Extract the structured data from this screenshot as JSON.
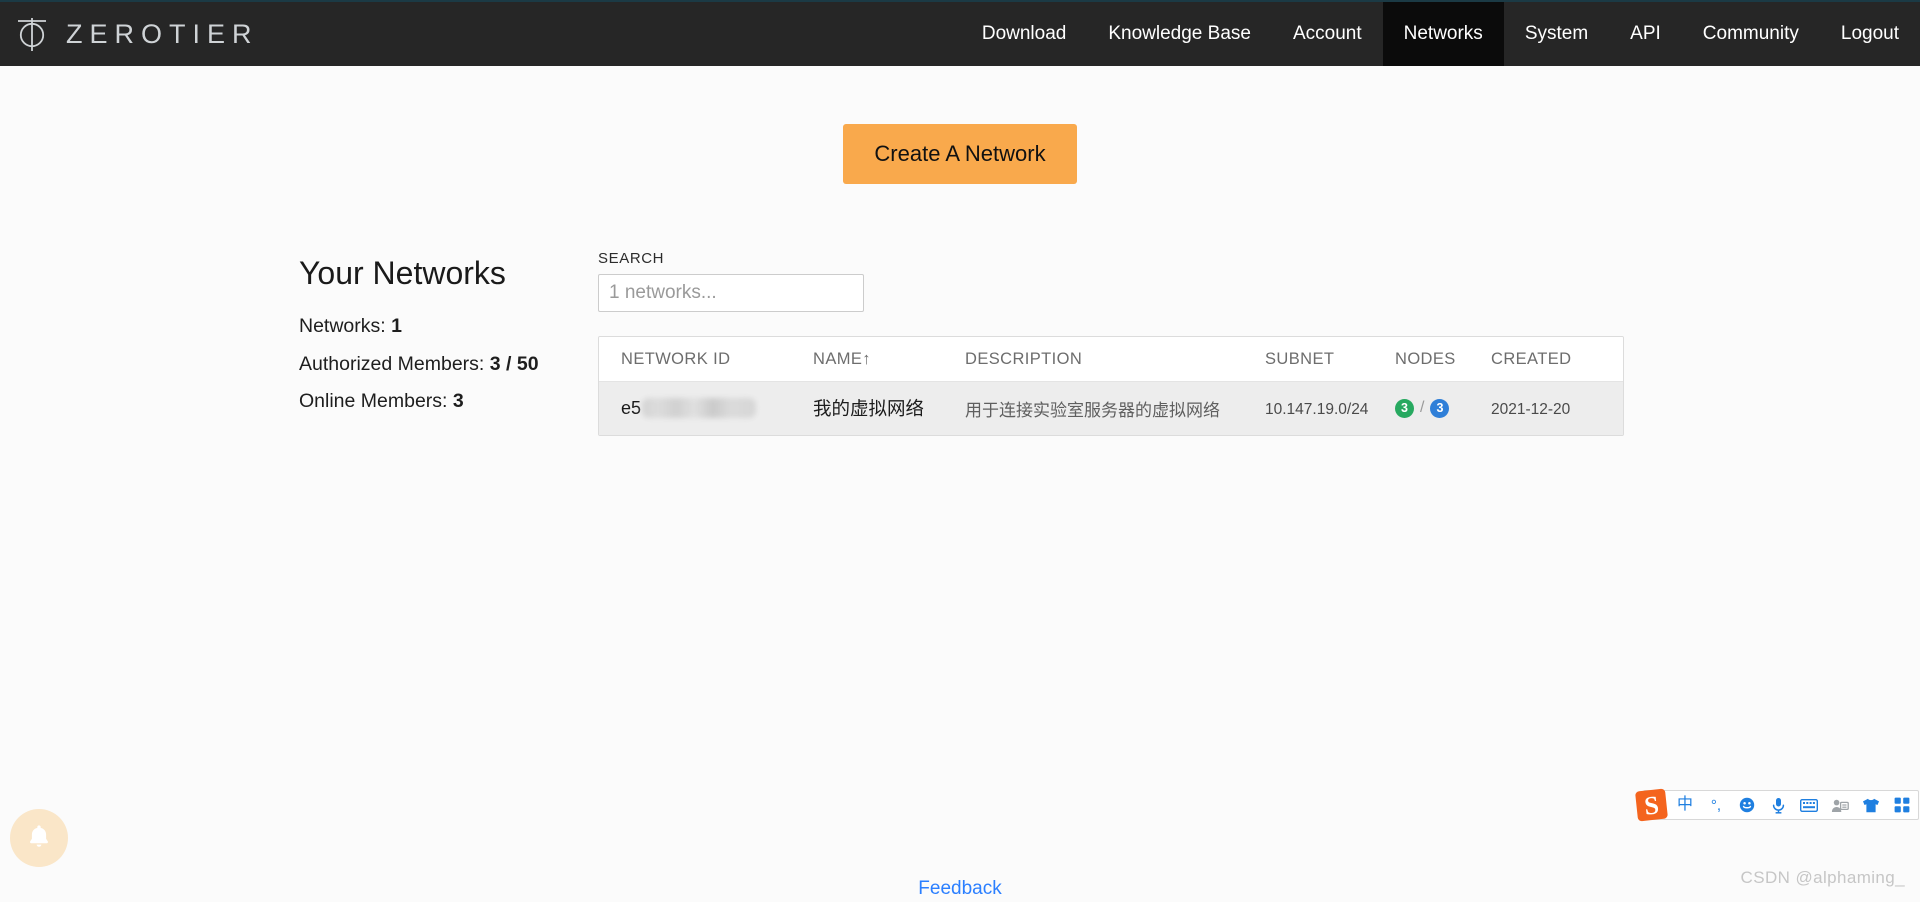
{
  "brand": {
    "name": "ZEROTIER",
    "logo_icon": "zerotier-logo-icon"
  },
  "nav": {
    "items": [
      {
        "label": "Download",
        "active": false
      },
      {
        "label": "Knowledge Base",
        "active": false
      },
      {
        "label": "Account",
        "active": false
      },
      {
        "label": "Networks",
        "active": true
      },
      {
        "label": "System",
        "active": false
      },
      {
        "label": "API",
        "active": false
      },
      {
        "label": "Community",
        "active": false
      },
      {
        "label": "Logout",
        "active": false
      }
    ]
  },
  "actions": {
    "create_network_label": "Create A Network"
  },
  "summary": {
    "title": "Your Networks",
    "networks_label": "Networks:",
    "networks_value": "1",
    "authorized_label": "Authorized Members:",
    "authorized_value": "3 / 50",
    "online_label": "Online Members:",
    "online_value": "3"
  },
  "search": {
    "label": "SEARCH",
    "value": "",
    "placeholder": "1 networks..."
  },
  "table": {
    "columns": [
      {
        "key": "network_id",
        "label": "NETWORK ID"
      },
      {
        "key": "name",
        "label": "NAME↑"
      },
      {
        "key": "description",
        "label": "DESCRIPTION"
      },
      {
        "key": "subnet",
        "label": "SUBNET"
      },
      {
        "key": "nodes",
        "label": "NODES"
      },
      {
        "key": "created",
        "label": "CREATED"
      }
    ],
    "sorted_by": "NAME",
    "sort_direction": "ascending",
    "rows": [
      {
        "network_id_visible": "e5",
        "network_id_redacted": true,
        "name": "我的虚拟网络",
        "description": "用于连接实验室服务器的虚拟网络",
        "subnet": "10.147.19.0/24",
        "nodes_online": "3",
        "nodes_total": "3",
        "nodes_separator": "/",
        "created": "2021-12-20"
      }
    ]
  },
  "floating": {
    "bell_icon": "bell-icon"
  },
  "footer": {
    "feedback_label": "Feedback"
  },
  "ime": {
    "logo_letter": "S",
    "items": [
      {
        "name": "chinese-mode",
        "glyph": "中"
      },
      {
        "name": "punctuation-mode",
        "glyph": "°,"
      },
      {
        "name": "emoji",
        "glyph": "☺"
      },
      {
        "name": "voice-input",
        "glyph": "🎤"
      },
      {
        "name": "soft-keyboard",
        "glyph": "⌨"
      },
      {
        "name": "user-card",
        "glyph": "👤"
      },
      {
        "name": "skin",
        "glyph": "👕"
      },
      {
        "name": "toolbox",
        "glyph": "▦"
      }
    ]
  },
  "watermark": {
    "text": "CSDN @alphaming_"
  },
  "colors": {
    "navbar_bg": "#262626",
    "nav_active_bg": "#0b0b0b",
    "create_button": "#f9a94c",
    "row_bg": "#ededed",
    "badge_online": "#27a960",
    "badge_total": "#2f7fd8",
    "link": "#2b7fff",
    "bell_bg": "#fae6c8"
  }
}
